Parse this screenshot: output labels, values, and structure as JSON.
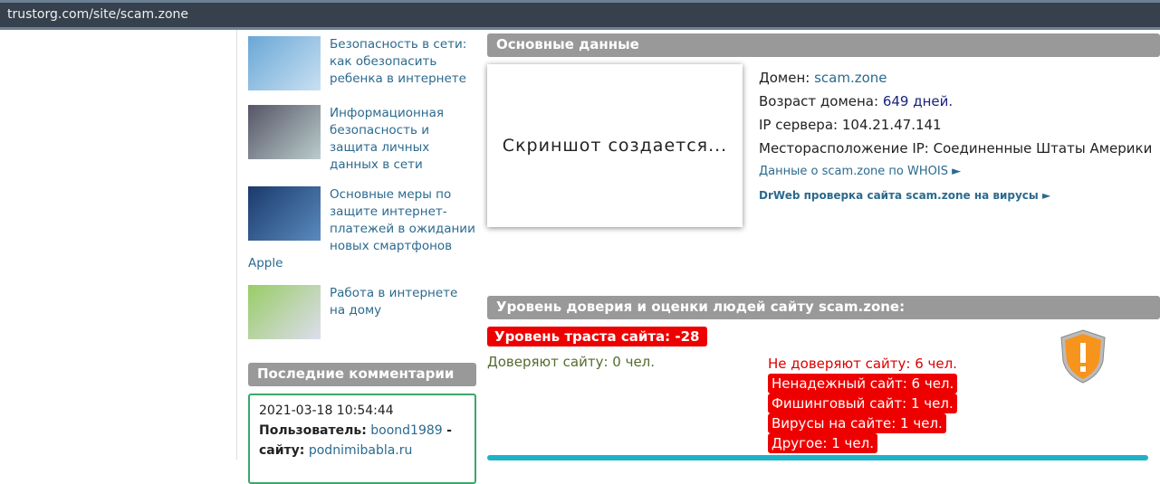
{
  "address_bar": {
    "url": "trustorg.com/site/scam.zone"
  },
  "articles": [
    {
      "title": "Безопасность в сети: как обезопасить ребенка в интернете"
    },
    {
      "title": "Информационная безопасность и защита личных данных в сети"
    },
    {
      "title": "Основные меры по защите интернет-платежей в ожидании новых смартфонов",
      "tail": "Apple"
    },
    {
      "title": "Работа в интернете на дому"
    }
  ],
  "comments": {
    "header": "Последние комментарии",
    "date": "2021-03-18 10:54:44",
    "user_label": "Пользователь:",
    "user": "boond1989",
    "dash": "-",
    "site_label": "сайту:",
    "site": "podnimibabla.ru"
  },
  "main": {
    "header": "Основные данные",
    "screenshot_text": "Скриншот создается...",
    "domain_label": "Домен:",
    "domain": "scam.zone",
    "age_label": "Возраст домена:",
    "age": "649 дней.",
    "ip_label": "IP сервера:",
    "ip": "104.21.47.141",
    "loc_label": "Месторасположение IP:",
    "loc": "Соединенные Штаты Америки",
    "whois": "Данные о scam.zone по WHOIS ►",
    "drweb": "DrWeb проверка сайта scam.zone на вирусы ►"
  },
  "trust": {
    "header": "Уровень доверия и оценки людей сайту scam.zone:",
    "level": "Уровень траста сайта: -28",
    "trust_count": "Доверяют сайту: 0 чел.",
    "distrust": "Не доверяют сайту: 6 чел.",
    "reasons": [
      "Ненадежный сайт: 6 чел.",
      "Фишинговый сайт: 1 чел.",
      "Вирусы на сайте: 1 чел.",
      "Другое: 1 чел."
    ]
  }
}
